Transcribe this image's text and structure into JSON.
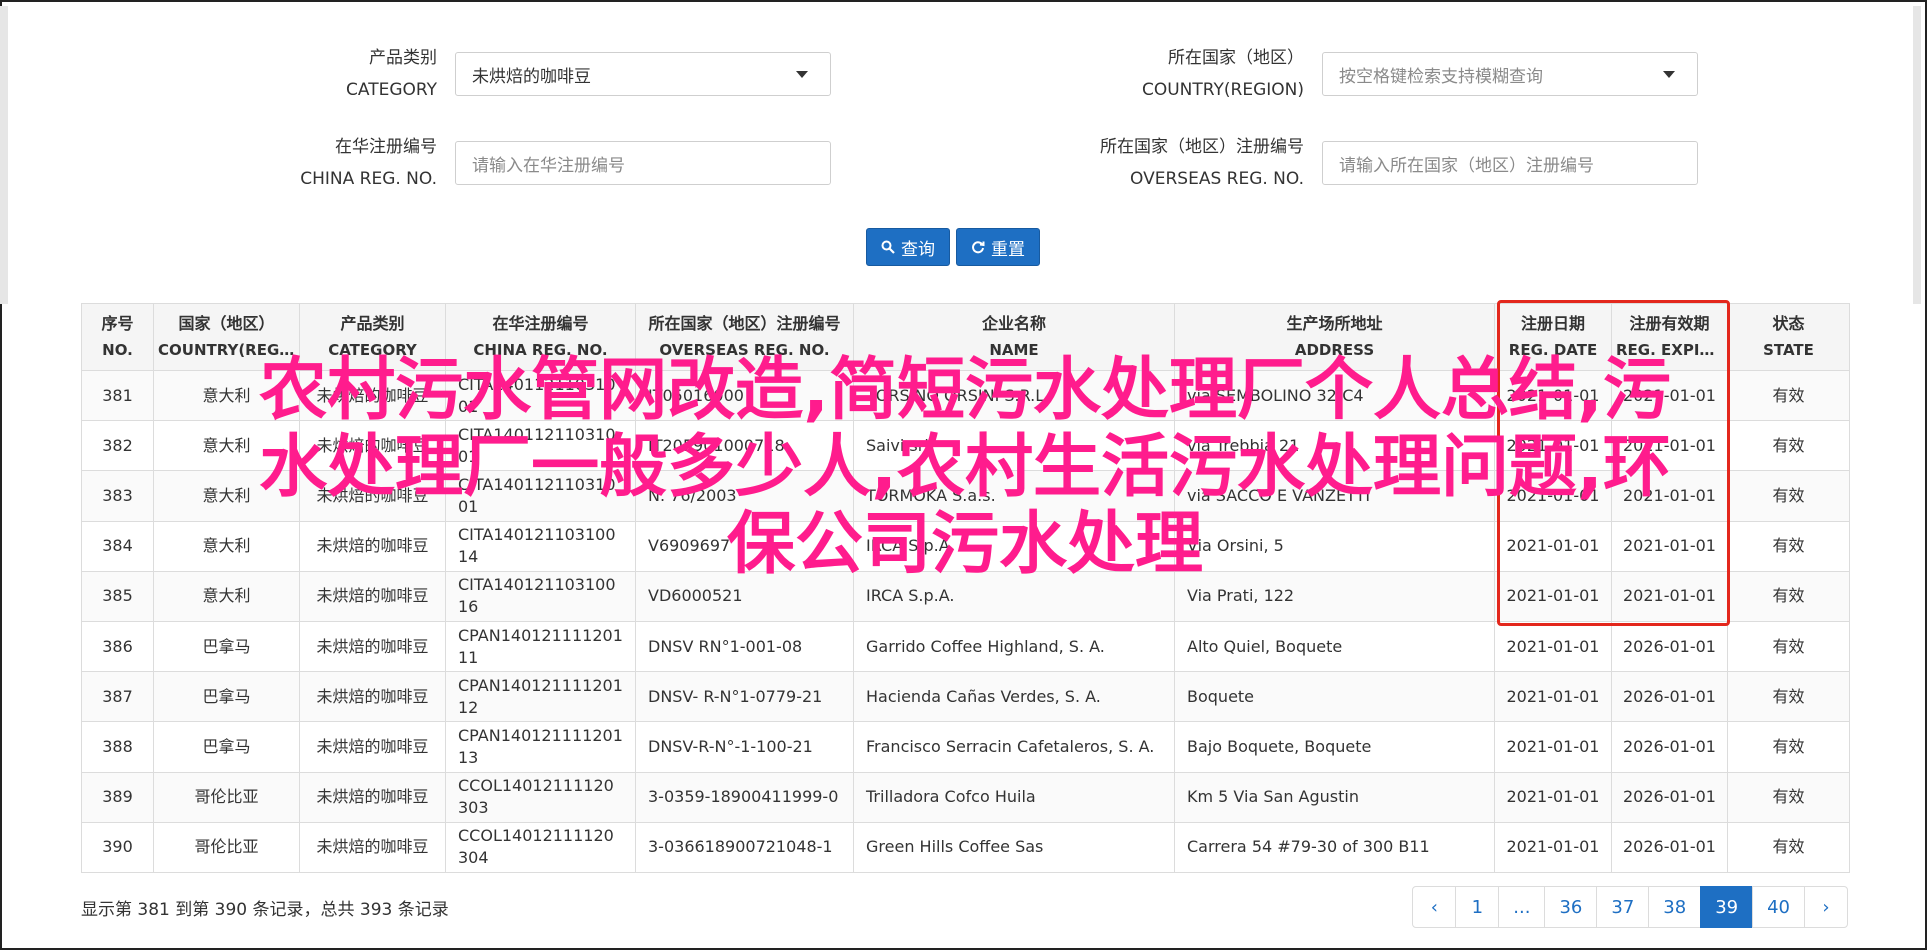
{
  "filters": {
    "category": {
      "label_cn": "产品类别",
      "label_en": "CATEGORY",
      "value": "未烘焙的咖啡豆"
    },
    "country": {
      "label_cn": "所在国家（地区）",
      "label_en": "COUNTRY(REGION)",
      "placeholder": "按空格键检索支持模糊查询"
    },
    "china_reg": {
      "label_cn": "在华注册编号",
      "label_en": "CHINA REG. NO.",
      "placeholder": "请输入在华注册编号"
    },
    "overseas_reg": {
      "label_cn": "所在国家（地区）注册编号",
      "label_en": "OVERSEAS REG. NO.",
      "placeholder": "请输入所在国家（地区）注册编号"
    }
  },
  "buttons": {
    "search": "查询",
    "reset": "重置"
  },
  "table": {
    "headers": [
      {
        "cn": "序号",
        "en": "NO."
      },
      {
        "cn": "国家（地区）",
        "en": "COUNTRY(REGIO..."
      },
      {
        "cn": "产品类别",
        "en": "CATEGORY"
      },
      {
        "cn": "在华注册编号",
        "en": "CHINA REG. NO."
      },
      {
        "cn": "所在国家（地区）注册编号",
        "en": "OVERSEAS REG. NO."
      },
      {
        "cn": "企业名称",
        "en": "NAME"
      },
      {
        "cn": "生产场所地址",
        "en": "ADDRESS"
      },
      {
        "cn": "注册日期",
        "en": "REG. DATE"
      },
      {
        "cn": "注册有效期",
        "en": "REG. EXPIRE ..."
      },
      {
        "cn": "状态",
        "en": "STATE"
      }
    ],
    "rows": [
      [
        "381",
        "意大利",
        "未烘焙的咖啡豆",
        "CITA14011211031001",
        "IT05016000",
        "TORSINO ORSINI S.R.L.",
        "via SEMBOLINO 32/C4",
        "2021-01-01",
        "2021-01-01",
        "有效"
      ],
      [
        "382",
        "意大利",
        "未烘焙的咖啡豆",
        "CITA14011211031001",
        "IT205901000718",
        "Saivi srl",
        "via Trebbia 21",
        "2021-01-01",
        "2021-01-01",
        "有效"
      ],
      [
        "383",
        "意大利",
        "未烘焙的咖啡豆",
        "CITA14011211031001",
        "N. 76/2003",
        "TORMOKA S.a.s.",
        "via SACCO E VANZETTI",
        "2021-01-01",
        "2021-01-01",
        "有效"
      ],
      [
        "384",
        "意大利",
        "未烘焙的咖啡豆",
        "CITA140121103100 14",
        "V6909697",
        "IRCA S.p.A.",
        "Via Orsini, 5",
        "2021-01-01",
        "2021-01-01",
        "有效"
      ],
      [
        "385",
        "意大利",
        "未烘焙的咖啡豆",
        "CITA140121103100 16",
        "VD6000521",
        "IRCA S.p.A.",
        "Via Prati, 122",
        "2021-01-01",
        "2021-01-01",
        "有效"
      ],
      [
        "386",
        "巴拿马",
        "未烘焙的咖啡豆",
        "CPAN14012111120111",
        "DNSV RN°1-001-08",
        "Garrido Coffee Highland, S. A.",
        "Alto Quiel, Boquete",
        "2021-01-01",
        "2026-01-01",
        "有效"
      ],
      [
        "387",
        "巴拿马",
        "未烘焙的咖啡豆",
        "CPAN14012111120112",
        "DNSV- R-N°1-0779-21",
        "Hacienda Cañas Verdes, S. A.",
        "Boquete",
        "2021-01-01",
        "2026-01-01",
        "有效"
      ],
      [
        "388",
        "巴拿马",
        "未烘焙的咖啡豆",
        "CPAN14012111120113",
        "DNSV-R-N°-1-100-21",
        "Francisco Serracin Cafetaleros, S. A.",
        "Bajo Boquete, Boquete",
        "2021-01-01",
        "2026-01-01",
        "有效"
      ],
      [
        "389",
        "哥伦比亚",
        "未烘焙的咖啡豆",
        "CCOL14012111120303",
        "3-0359-18900411999-0",
        "Trilladora Cofco Huila",
        "Km 5 Via San Agustin",
        "2021-01-01",
        "2026-01-01",
        "有效"
      ],
      [
        "390",
        "哥伦比亚",
        "未烘焙的咖啡豆",
        "CCOL14012111120304",
        "3-036618900721048-1",
        "Green Hills Coffee Sas",
        "Carrera 54 #79-30 of 300 B11",
        "2021-01-01",
        "2026-01-01",
        "有效"
      ]
    ]
  },
  "overlay": {
    "line1": "农村污水管网改造,简短污水处理厂个人总结,污",
    "line2": "水处理厂一般多少人,农村生活污水处理问题,环",
    "line3": "保公司污水处理"
  },
  "footer": {
    "summary": "显示第 381 到第 390 条记录，总共 393 条记录",
    "pages": [
      "‹",
      "1",
      "...",
      "36",
      "37",
      "38",
      "39",
      "40",
      "›"
    ],
    "active_page": "39"
  },
  "colors": {
    "primary": "#1e6fc3",
    "overlay_text": "#ff1c8d",
    "highlight_box": "#e3271c"
  }
}
